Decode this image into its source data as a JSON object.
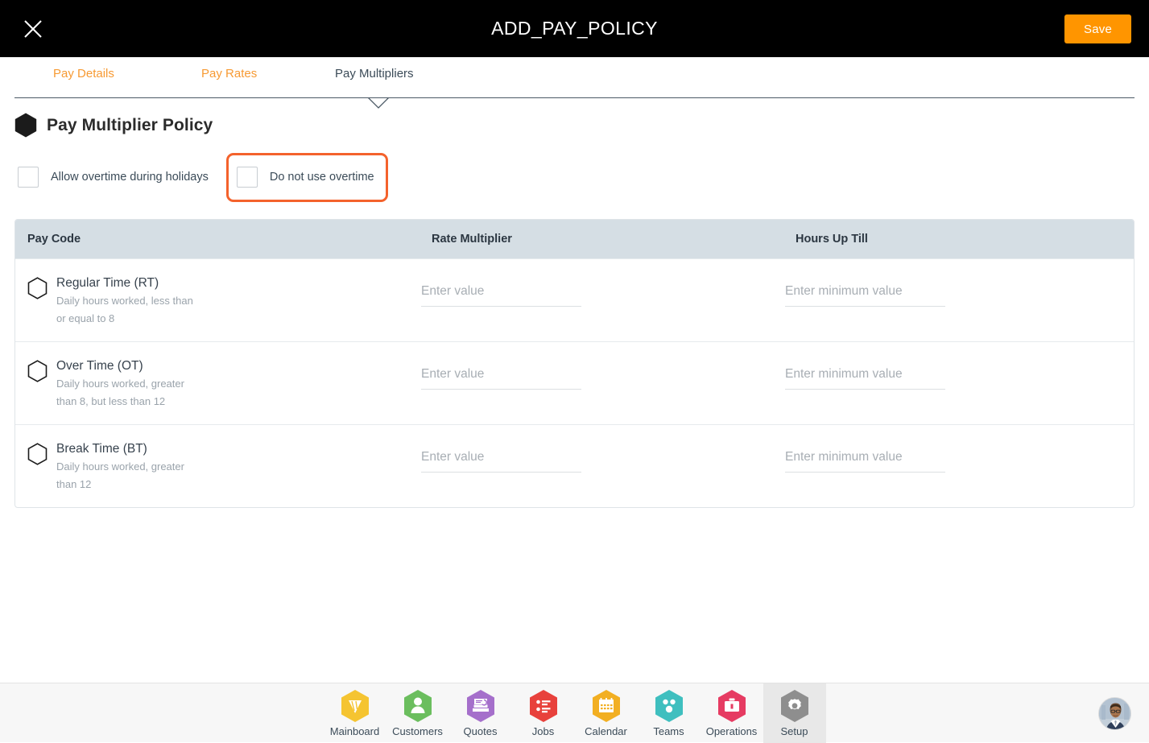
{
  "topbar": {
    "title": "ADD_PAY_POLICY",
    "close_icon": "close-icon",
    "save_label": "Save"
  },
  "tabs": [
    {
      "label": "Pay Details",
      "active": false
    },
    {
      "label": "Pay Rates",
      "active": false
    },
    {
      "label": "Pay Multipliers",
      "active": true
    }
  ],
  "section": {
    "icon": "hexagon-filled-icon",
    "title": "Pay Multiplier Policy"
  },
  "checkboxes": [
    {
      "label": "Allow overtime during holidays",
      "checked": false,
      "highlighted": false
    },
    {
      "label": "Do not use overtime",
      "checked": false,
      "highlighted": true
    }
  ],
  "table": {
    "headers": [
      "Pay Code",
      "Rate Multiplier",
      "Hours Up Till"
    ],
    "rows": [
      {
        "icon": "hexagon-outline-icon",
        "name": "Regular Time (RT)",
        "description": "Daily hours worked, less than or equal to 8",
        "rate_multiplier_value": "",
        "rate_multiplier_placeholder": "Enter value",
        "hours_up_till_value": "",
        "hours_up_till_placeholder": "Enter minimum value"
      },
      {
        "icon": "hexagon-outline-icon",
        "name": "Over Time (OT)",
        "description": "Daily hours worked, greater than 8, but less than 12",
        "rate_multiplier_value": "",
        "rate_multiplier_placeholder": "Enter value",
        "hours_up_till_value": "",
        "hours_up_till_placeholder": "Enter minimum value"
      },
      {
        "icon": "hexagon-outline-icon",
        "name": "Break Time (BT)",
        "description": "Daily hours worked, greater than 12",
        "rate_multiplier_value": "",
        "rate_multiplier_placeholder": "Enter value",
        "hours_up_till_value": "",
        "hours_up_till_placeholder": "Enter minimum value"
      }
    ]
  },
  "bottom_nav": {
    "items": [
      {
        "label": "Mainboard",
        "icon": "mainboard-icon",
        "color": "#F5C431",
        "active": false
      },
      {
        "label": "Customers",
        "icon": "customers-icon",
        "color": "#6BBE5E",
        "active": false
      },
      {
        "label": "Quotes",
        "icon": "quotes-icon",
        "color": "#A56FCB",
        "active": false
      },
      {
        "label": "Jobs",
        "icon": "jobs-icon",
        "color": "#E8413C",
        "active": false
      },
      {
        "label": "Calendar",
        "icon": "calendar-icon",
        "color": "#F2AF22",
        "active": false
      },
      {
        "label": "Teams",
        "icon": "teams-icon",
        "color": "#3FBFBF",
        "active": false
      },
      {
        "label": "Operations",
        "icon": "operations-icon",
        "color": "#E63B62",
        "active": false
      },
      {
        "label": "Setup",
        "icon": "gear-icon",
        "color": "#8E8E8E",
        "active": true
      }
    ],
    "avatar": "user-avatar"
  },
  "colors": {
    "accent_orange": "#FF9500",
    "highlight_orange": "#F4622C",
    "tab_orange": "#F79A33",
    "table_header_bg": "#D5DEE4",
    "topbar_bg": "#000000"
  }
}
